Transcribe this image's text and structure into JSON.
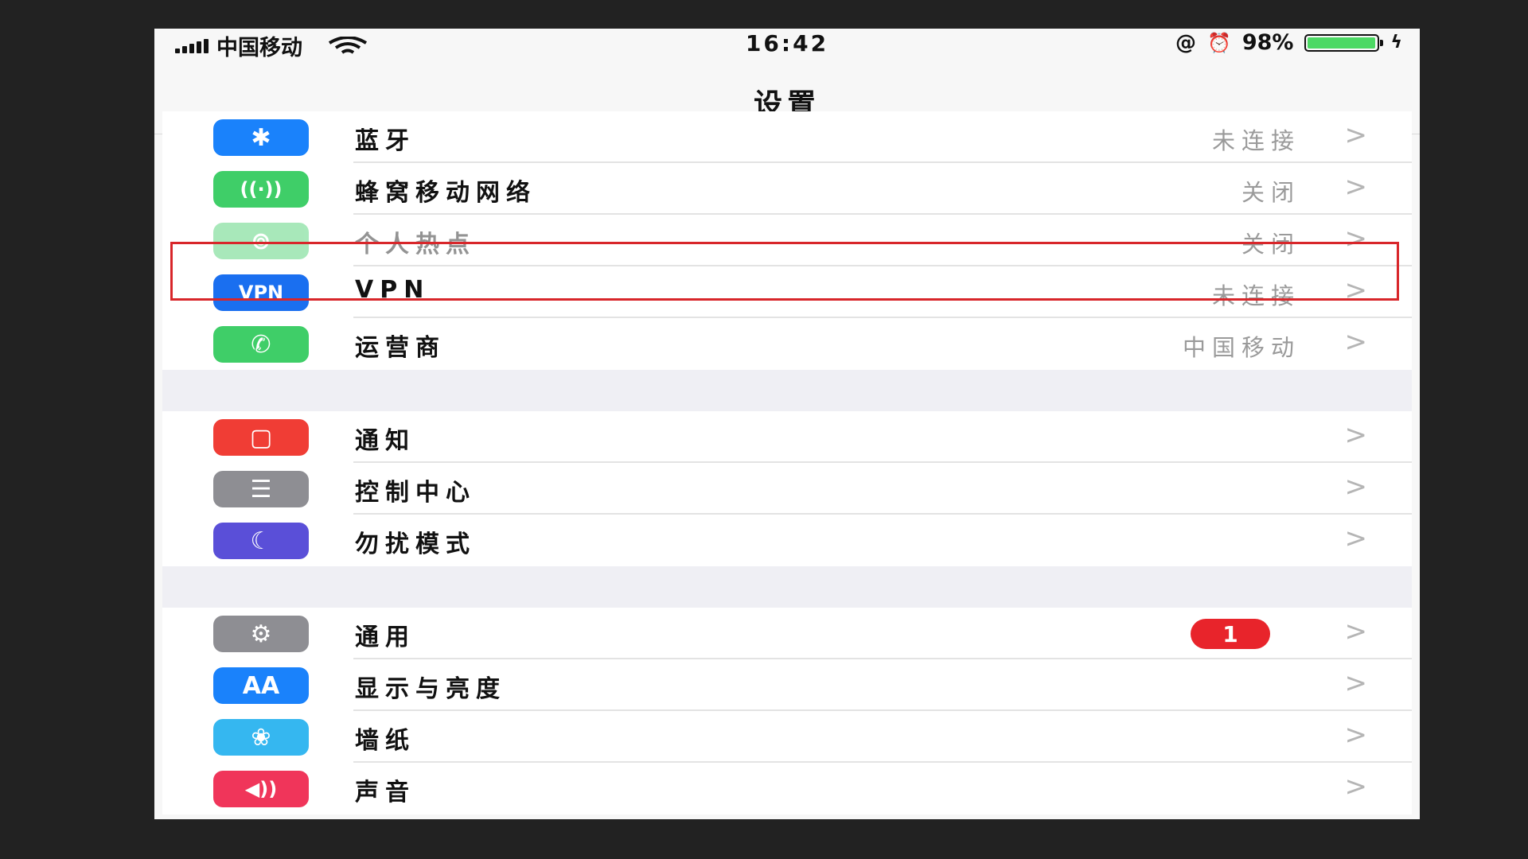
{
  "status_bar": {
    "carrier": "中国移动",
    "time": "16:42",
    "battery_percent": "98%",
    "battery_level": 0.98
  },
  "nav": {
    "title": "设置"
  },
  "groups": [
    {
      "items": [
        {
          "label": "蓝牙",
          "value": "未连接",
          "icon": "bluetooth-icon",
          "color": "#1a82fb",
          "glyph": "✱",
          "dim": false
        },
        {
          "label": "蜂窝移动网络",
          "value": "关闭",
          "icon": "cellular-antenna-icon",
          "color": "#3fce68",
          "glyph": "((·))",
          "dim": false
        },
        {
          "label": "个人热点",
          "value": "关闭",
          "icon": "hotspot-chain-icon",
          "color": "#3fce68",
          "glyph": "⊚",
          "dim": true
        },
        {
          "label": "VPN",
          "value": "未连接",
          "icon": "vpn-icon",
          "color": "#1a6ff0",
          "glyph": "VPN",
          "dim": false,
          "highlighted": true
        },
        {
          "label": "运营商",
          "value": "中国移动",
          "icon": "phone-icon",
          "color": "#3fce68",
          "glyph": "✆",
          "dim": false
        }
      ]
    },
    {
      "items": [
        {
          "label": "通知",
          "value": "",
          "icon": "notifications-icon",
          "color": "#f03d35",
          "glyph": "▢",
          "dim": false
        },
        {
          "label": "控制中心",
          "value": "",
          "icon": "control-center-icon",
          "color": "#8e8e93",
          "glyph": "☰",
          "dim": false
        },
        {
          "label": "勿扰模式",
          "value": "",
          "icon": "moon-icon",
          "color": "#5a4fd8",
          "glyph": "☾",
          "dim": false
        }
      ]
    },
    {
      "items": [
        {
          "label": "通用",
          "value": "",
          "badge": "1",
          "icon": "gear-icon",
          "color": "#8e8e93",
          "glyph": "⚙",
          "dim": false
        },
        {
          "label": "显示与亮度",
          "value": "",
          "icon": "display-aa-icon",
          "color": "#1a82fb",
          "glyph": "AA",
          "dim": false
        },
        {
          "label": "墙纸",
          "value": "",
          "icon": "wallpaper-flower-icon",
          "color": "#35b7f0",
          "glyph": "❀",
          "dim": false
        },
        {
          "label": "声音",
          "value": "",
          "icon": "speaker-icon",
          "color": "#f0355a",
          "glyph": "◀))",
          "dim": false
        }
      ]
    }
  ],
  "chevron": ">"
}
